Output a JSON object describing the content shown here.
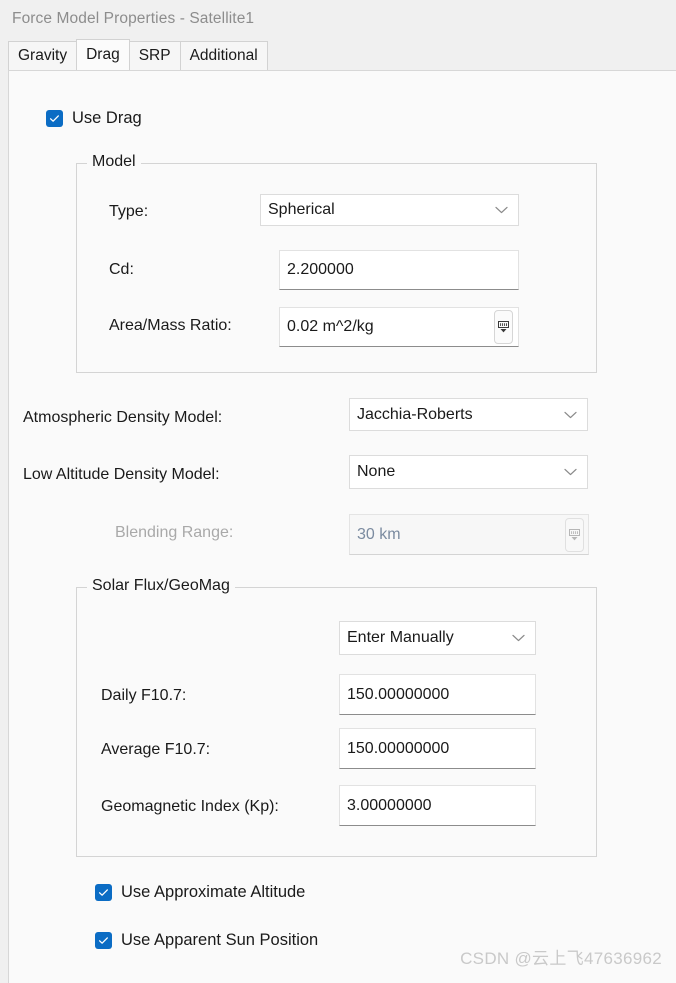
{
  "window": {
    "title": "Force Model Properties - Satellite1"
  },
  "tabs": [
    {
      "label": "Gravity",
      "selected": false
    },
    {
      "label": "Drag",
      "selected": true
    },
    {
      "label": "SRP",
      "selected": false
    },
    {
      "label": "Additional",
      "selected": false
    }
  ],
  "use_drag": {
    "label": "Use Drag",
    "checked": true
  },
  "model_group": {
    "title": "Model",
    "type": {
      "label": "Type:",
      "value": "Spherical"
    },
    "cd": {
      "label": "Cd:",
      "value": "2.200000"
    },
    "area_mass_ratio": {
      "label": "Area/Mass Ratio:",
      "value": "0.02 m^2/kg"
    }
  },
  "atmospheric_density_model": {
    "label": "Atmospheric Density Model:",
    "value": "Jacchia-Roberts"
  },
  "low_altitude_density_model": {
    "label": "Low Altitude Density Model:",
    "value": "None"
  },
  "blending_range": {
    "label": "Blending Range:",
    "value": "30 km",
    "disabled": true
  },
  "solar_flux_group": {
    "title": "Solar Flux/GeoMag",
    "source": {
      "value": "Enter Manually"
    },
    "daily_f107": {
      "label": "Daily F10.7:",
      "value": "150.00000000"
    },
    "average_f107": {
      "label": "Average F10.7:",
      "value": "150.00000000"
    },
    "geomagnetic_index": {
      "label": "Geomagnetic Index (Kp):",
      "value": "3.00000000"
    }
  },
  "use_approximate_altitude": {
    "label": "Use Approximate Altitude",
    "checked": true
  },
  "use_apparent_sun_position": {
    "label": "Use Apparent Sun Position",
    "checked": true
  },
  "watermark": {
    "text": "CSDN @云上飞47636962"
  },
  "colors": {
    "accent": "#0b6cc4",
    "titlebar_bg": "#f0f0f0",
    "panel_bg": "#fafafa",
    "border": "#d4d4d4",
    "disabled_text": "#a9a9a9"
  }
}
